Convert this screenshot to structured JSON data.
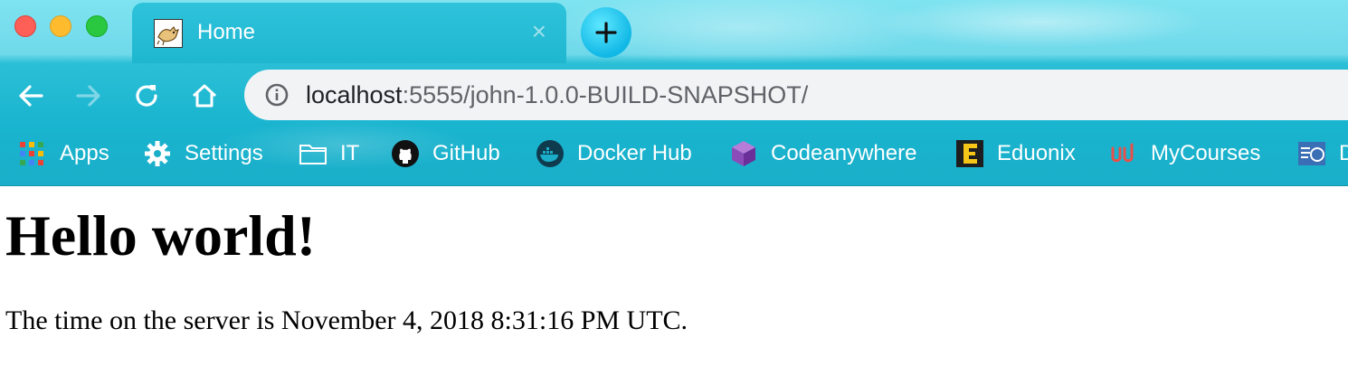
{
  "window": {
    "controls": [
      "close",
      "minimize",
      "maximize"
    ]
  },
  "tab": {
    "title": "Home",
    "favicon": "tomcat-icon",
    "close_glyph": "×"
  },
  "new_tab_glyph": "+",
  "nav": {
    "back": "arrow-left-icon",
    "forward": "arrow-right-icon",
    "reload": "reload-icon",
    "home": "home-icon"
  },
  "omnibox": {
    "host": "localhost",
    "rest": ":5555/john-1.0.0-BUILD-SNAPSHOT/"
  },
  "bookmarks": [
    {
      "label": "Apps",
      "icon": "apps-grid-icon"
    },
    {
      "label": "Settings",
      "icon": "gear-icon"
    },
    {
      "label": "IT",
      "icon": "folder-icon"
    },
    {
      "label": "GitHub",
      "icon": "github-icon"
    },
    {
      "label": "Docker Hub",
      "icon": "docker-icon"
    },
    {
      "label": "Codeanywhere",
      "icon": "codeanywhere-icon"
    },
    {
      "label": "Eduonix",
      "icon": "eduonix-icon"
    },
    {
      "label": "MyCourses",
      "icon": "udemy-icon"
    },
    {
      "label": "D",
      "icon": "bookmark-icon"
    }
  ],
  "page": {
    "heading": "Hello world!",
    "paragraph": "The time on the server is November 4, 2018 8:31:16 PM UTC."
  },
  "colors": {
    "toolbar": "#1aaec9",
    "tab": "#1fb6d0",
    "omnibox": "#f1f3f4",
    "new_tab": "#11b8e6"
  }
}
